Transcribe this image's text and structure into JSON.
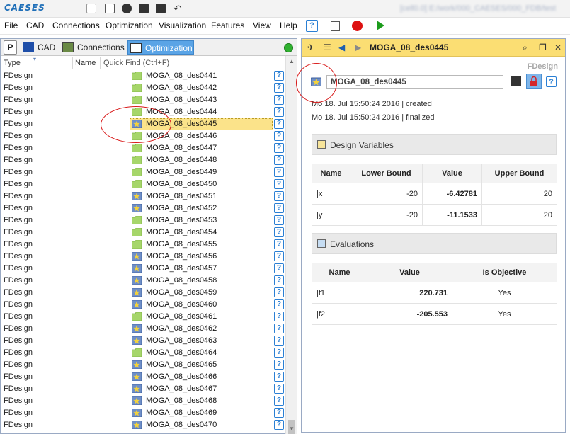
{
  "app": {
    "logo_text": "CAESES",
    "title_path": "[cell0.0] E:/work/000_CAESES/000_FDB/test"
  },
  "menu": {
    "items": [
      "File",
      "CAD",
      "Connections",
      "Optimization",
      "Visualization",
      "Features",
      "View",
      "Help"
    ],
    "help_icon": "?"
  },
  "left_panel": {
    "tab_p_label": "P",
    "tabs": [
      "CAD",
      "Connections",
      "Optimization"
    ],
    "active_tab": "Optimization",
    "columns": {
      "type": "Type",
      "name": "Name",
      "quick_find": "Quick Find (Ctrl+F)"
    },
    "help_glyph": "?",
    "rows": [
      {
        "type": "FDesign",
        "name": "MOGA_08_des0441",
        "icon": "folder-green"
      },
      {
        "type": "FDesign",
        "name": "MOGA_08_des0442",
        "icon": "folder-green"
      },
      {
        "type": "FDesign",
        "name": "MOGA_08_des0443",
        "icon": "folder-green"
      },
      {
        "type": "FDesign",
        "name": "MOGA_08_des0444",
        "icon": "folder-green"
      },
      {
        "type": "FDesign",
        "name": "MOGA_08_des0445",
        "icon": "star-design",
        "selected": true
      },
      {
        "type": "FDesign",
        "name": "MOGA_08_des0446",
        "icon": "folder-green"
      },
      {
        "type": "FDesign",
        "name": "MOGA_08_des0447",
        "icon": "folder-green"
      },
      {
        "type": "FDesign",
        "name": "MOGA_08_des0448",
        "icon": "folder-green"
      },
      {
        "type": "FDesign",
        "name": "MOGA_08_des0449",
        "icon": "folder-green"
      },
      {
        "type": "FDesign",
        "name": "MOGA_08_des0450",
        "icon": "folder-green"
      },
      {
        "type": "FDesign",
        "name": "MOGA_08_des0451",
        "icon": "star-design"
      },
      {
        "type": "FDesign",
        "name": "MOGA_08_des0452",
        "icon": "star-design"
      },
      {
        "type": "FDesign",
        "name": "MOGA_08_des0453",
        "icon": "folder-green"
      },
      {
        "type": "FDesign",
        "name": "MOGA_08_des0454",
        "icon": "folder-green"
      },
      {
        "type": "FDesign",
        "name": "MOGA_08_des0455",
        "icon": "folder-green"
      },
      {
        "type": "FDesign",
        "name": "MOGA_08_des0456",
        "icon": "star-design"
      },
      {
        "type": "FDesign",
        "name": "MOGA_08_des0457",
        "icon": "star-design"
      },
      {
        "type": "FDesign",
        "name": "MOGA_08_des0458",
        "icon": "star-design"
      },
      {
        "type": "FDesign",
        "name": "MOGA_08_des0459",
        "icon": "star-design"
      },
      {
        "type": "FDesign",
        "name": "MOGA_08_des0460",
        "icon": "star-design"
      },
      {
        "type": "FDesign",
        "name": "MOGA_08_des0461",
        "icon": "folder-green"
      },
      {
        "type": "FDesign",
        "name": "MOGA_08_des0462",
        "icon": "star-design"
      },
      {
        "type": "FDesign",
        "name": "MOGA_08_des0463",
        "icon": "star-design"
      },
      {
        "type": "FDesign",
        "name": "MOGA_08_des0464",
        "icon": "folder-green"
      },
      {
        "type": "FDesign",
        "name": "MOGA_08_des0465",
        "icon": "star-design"
      },
      {
        "type": "FDesign",
        "name": "MOGA_08_des0466",
        "icon": "star-design"
      },
      {
        "type": "FDesign",
        "name": "MOGA_08_des0467",
        "icon": "star-design"
      },
      {
        "type": "FDesign",
        "name": "MOGA_08_des0468",
        "icon": "star-design"
      },
      {
        "type": "FDesign",
        "name": "MOGA_08_des0469",
        "icon": "star-design"
      },
      {
        "type": "FDesign",
        "name": "MOGA_08_des0470",
        "icon": "star-design"
      }
    ]
  },
  "right_panel": {
    "header_title": "MOGA_08_des0445",
    "type_label": "FDesign",
    "name_value": "MOGA_08_des0445",
    "created": "Mo 18. Jul 15:50:24 2016 | created",
    "finalized": "Mo 18. Jul 15:50:24 2016 | finalized",
    "help_glyph": "?",
    "design_variables": {
      "title": "Design Variables",
      "headers": [
        "Name",
        "Lower Bound",
        "Value",
        "Upper Bound"
      ],
      "rows": [
        {
          "name": "|x",
          "lower": "-20",
          "value": "-6.42781",
          "upper": "20"
        },
        {
          "name": "|y",
          "lower": "-20",
          "value": "-11.1533",
          "upper": "20"
        }
      ]
    },
    "evaluations": {
      "title": "Evaluations",
      "headers": [
        "Name",
        "Value",
        "Is Objective"
      ],
      "rows": [
        {
          "name": "|f1",
          "value": "220.731",
          "objective": "Yes"
        },
        {
          "name": "|f2",
          "value": "-205.553",
          "objective": "Yes"
        }
      ]
    }
  },
  "colors": {
    "accent_blue": "#5aa4e6",
    "header_yellow": "#fbde73",
    "selection_yellow": "#fbe38a",
    "folder_green": "#a6d66a",
    "annotation_red": "#d91b1b"
  }
}
